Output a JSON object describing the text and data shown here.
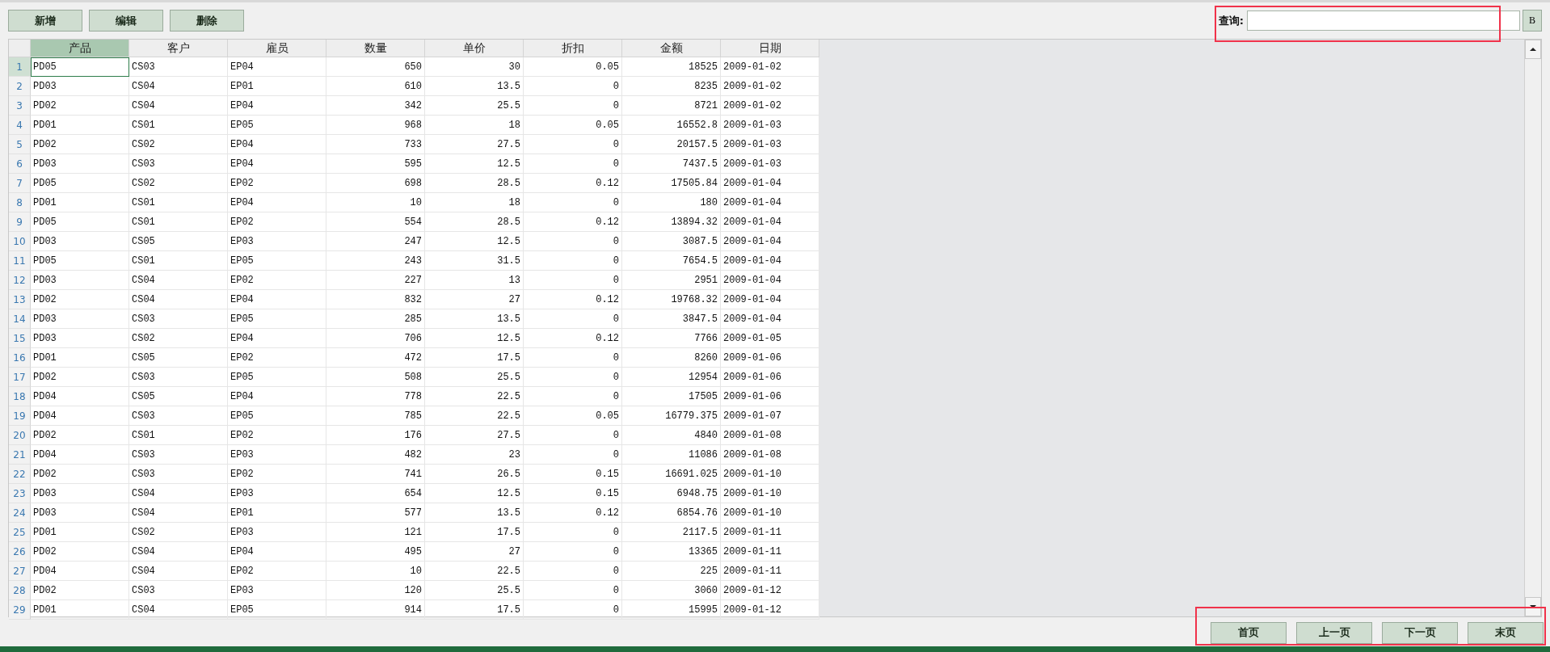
{
  "toolbar": {
    "buttons": [
      "新增",
      "编辑",
      "删除"
    ]
  },
  "search": {
    "label": "查询:",
    "button": "B"
  },
  "table": {
    "columns": [
      {
        "label": "产品",
        "kind": "text",
        "selected": true
      },
      {
        "label": "客户",
        "kind": "text",
        "selected": false
      },
      {
        "label": "雇员",
        "kind": "text",
        "selected": false
      },
      {
        "label": "数量",
        "kind": "number",
        "selected": false
      },
      {
        "label": "单价",
        "kind": "number",
        "selected": false
      },
      {
        "label": "折扣",
        "kind": "number",
        "selected": false
      },
      {
        "label": "金额",
        "kind": "number",
        "selected": false
      },
      {
        "label": "日期",
        "kind": "text",
        "selected": false
      }
    ],
    "rows": [
      {
        "number": "1",
        "selected": true,
        "cells": [
          "PD05",
          "CS03",
          "EP04",
          "650",
          "30",
          "0.05",
          "18525",
          "2009-01-02"
        ]
      },
      {
        "number": "2",
        "selected": false,
        "cells": [
          "PD03",
          "CS04",
          "EP01",
          "610",
          "13.5",
          "0",
          "8235",
          "2009-01-02"
        ]
      },
      {
        "number": "3",
        "selected": false,
        "cells": [
          "PD02",
          "CS04",
          "EP04",
          "342",
          "25.5",
          "0",
          "8721",
          "2009-01-02"
        ]
      },
      {
        "number": "4",
        "selected": false,
        "cells": [
          "PD01",
          "CS01",
          "EP05",
          "968",
          "18",
          "0.05",
          "16552.8",
          "2009-01-03"
        ]
      },
      {
        "number": "5",
        "selected": false,
        "cells": [
          "PD02",
          "CS02",
          "EP04",
          "733",
          "27.5",
          "0",
          "20157.5",
          "2009-01-03"
        ]
      },
      {
        "number": "6",
        "selected": false,
        "cells": [
          "PD03",
          "CS03",
          "EP04",
          "595",
          "12.5",
          "0",
          "7437.5",
          "2009-01-03"
        ]
      },
      {
        "number": "7",
        "selected": false,
        "cells": [
          "PD05",
          "CS02",
          "EP02",
          "698",
          "28.5",
          "0.12",
          "17505.84",
          "2009-01-04"
        ]
      },
      {
        "number": "8",
        "selected": false,
        "cells": [
          "PD01",
          "CS01",
          "EP04",
          "10",
          "18",
          "0",
          "180",
          "2009-01-04"
        ]
      },
      {
        "number": "9",
        "selected": false,
        "cells": [
          "PD05",
          "CS01",
          "EP02",
          "554",
          "28.5",
          "0.12",
          "13894.32",
          "2009-01-04"
        ]
      },
      {
        "number": "10",
        "selected": false,
        "cells": [
          "PD03",
          "CS05",
          "EP03",
          "247",
          "12.5",
          "0",
          "3087.5",
          "2009-01-04"
        ]
      },
      {
        "number": "11",
        "selected": false,
        "cells": [
          "PD05",
          "CS01",
          "EP05",
          "243",
          "31.5",
          "0",
          "7654.5",
          "2009-01-04"
        ]
      },
      {
        "number": "12",
        "selected": false,
        "cells": [
          "PD03",
          "CS04",
          "EP02",
          "227",
          "13",
          "0",
          "2951",
          "2009-01-04"
        ]
      },
      {
        "number": "13",
        "selected": false,
        "cells": [
          "PD02",
          "CS04",
          "EP04",
          "832",
          "27",
          "0.12",
          "19768.32",
          "2009-01-04"
        ]
      },
      {
        "number": "14",
        "selected": false,
        "cells": [
          "PD03",
          "CS03",
          "EP05",
          "285",
          "13.5",
          "0",
          "3847.5",
          "2009-01-04"
        ]
      },
      {
        "number": "15",
        "selected": false,
        "cells": [
          "PD03",
          "CS02",
          "EP04",
          "706",
          "12.5",
          "0.12",
          "7766",
          "2009-01-05"
        ]
      },
      {
        "number": "16",
        "selected": false,
        "cells": [
          "PD01",
          "CS05",
          "EP02",
          "472",
          "17.5",
          "0",
          "8260",
          "2009-01-06"
        ]
      },
      {
        "number": "17",
        "selected": false,
        "cells": [
          "PD02",
          "CS03",
          "EP05",
          "508",
          "25.5",
          "0",
          "12954",
          "2009-01-06"
        ]
      },
      {
        "number": "18",
        "selected": false,
        "cells": [
          "PD04",
          "CS05",
          "EP04",
          "778",
          "22.5",
          "0",
          "17505",
          "2009-01-06"
        ]
      },
      {
        "number": "19",
        "selected": false,
        "cells": [
          "PD04",
          "CS03",
          "EP05",
          "785",
          "22.5",
          "0.05",
          "16779.375",
          "2009-01-07"
        ]
      },
      {
        "number": "20",
        "selected": false,
        "cells": [
          "PD02",
          "CS01",
          "EP02",
          "176",
          "27.5",
          "0",
          "4840",
          "2009-01-08"
        ]
      },
      {
        "number": "21",
        "selected": false,
        "cells": [
          "PD04",
          "CS03",
          "EP03",
          "482",
          "23",
          "0",
          "11086",
          "2009-01-08"
        ]
      },
      {
        "number": "22",
        "selected": false,
        "cells": [
          "PD02",
          "CS03",
          "EP02",
          "741",
          "26.5",
          "0.15",
          "16691.025",
          "2009-01-10"
        ]
      },
      {
        "number": "23",
        "selected": false,
        "cells": [
          "PD03",
          "CS04",
          "EP03",
          "654",
          "12.5",
          "0.15",
          "6948.75",
          "2009-01-10"
        ]
      },
      {
        "number": "24",
        "selected": false,
        "cells": [
          "PD03",
          "CS04",
          "EP01",
          "577",
          "13.5",
          "0.12",
          "6854.76",
          "2009-01-10"
        ]
      },
      {
        "number": "25",
        "selected": false,
        "cells": [
          "PD01",
          "CS02",
          "EP03",
          "121",
          "17.5",
          "0",
          "2117.5",
          "2009-01-11"
        ]
      },
      {
        "number": "26",
        "selected": false,
        "cells": [
          "PD02",
          "CS04",
          "EP04",
          "495",
          "27",
          "0",
          "13365",
          "2009-01-11"
        ]
      },
      {
        "number": "27",
        "selected": false,
        "cells": [
          "PD04",
          "CS04",
          "EP02",
          "10",
          "22.5",
          "0",
          "225",
          "2009-01-11"
        ]
      },
      {
        "number": "28",
        "selected": false,
        "cells": [
          "PD02",
          "CS03",
          "EP03",
          "120",
          "25.5",
          "0",
          "3060",
          "2009-01-12"
        ]
      },
      {
        "number": "29",
        "selected": false,
        "cells": [
          "PD01",
          "CS04",
          "EP05",
          "914",
          "17.5",
          "0",
          "15995",
          "2009-01-12"
        ]
      }
    ]
  },
  "pager": {
    "buttons": [
      "首页",
      "上一页",
      "下一页",
      "末页"
    ]
  }
}
